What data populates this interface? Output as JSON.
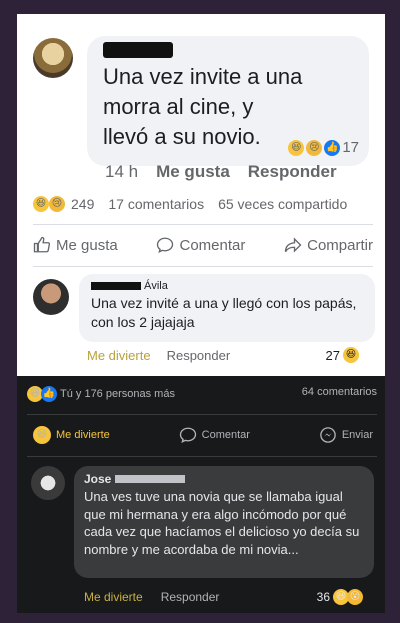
{
  "post": {
    "text": "Una vez invite a una morra al cine, y llevó a su novio.",
    "reaction_count": "17",
    "time": "14 h",
    "like_label": "Me gusta",
    "reply_label": "Responder"
  },
  "stats": {
    "reactions": "249",
    "comments": "17 comentarios",
    "shares": "65 veces compartido"
  },
  "action_bar": {
    "like": "Me gusta",
    "comment": "Comentar",
    "share": "Compartir"
  },
  "comment1": {
    "author_visible": "Ávila",
    "text": "Una vez invité a una y llegó con los papás, con los 2 jajajaja",
    "react_label": "Me divierte",
    "reply_label": "Responder",
    "count": "27"
  },
  "dark": {
    "reactions_text": "Tú y 176 personas más",
    "comments_text": "64 comentarios",
    "react_label": "Me divierte",
    "comment_label": "Comentar",
    "send_label": "Enviar"
  },
  "comment2": {
    "author_visible": "Jose",
    "text": "Una ves tuve una novia que se llamaba igual que mi hermana y era algo incómodo por qué cada vez que hacíamos el delicioso yo decía su nombre y me acordaba de mi novia...",
    "react_label": "Me divierte",
    "reply_label": "Responder",
    "count": "36"
  },
  "colors": {
    "fb_blue": "#1877f2",
    "haha_yellow": "#f7c53b",
    "light_bg": "#ffffff",
    "dark_bg": "#18191a"
  }
}
